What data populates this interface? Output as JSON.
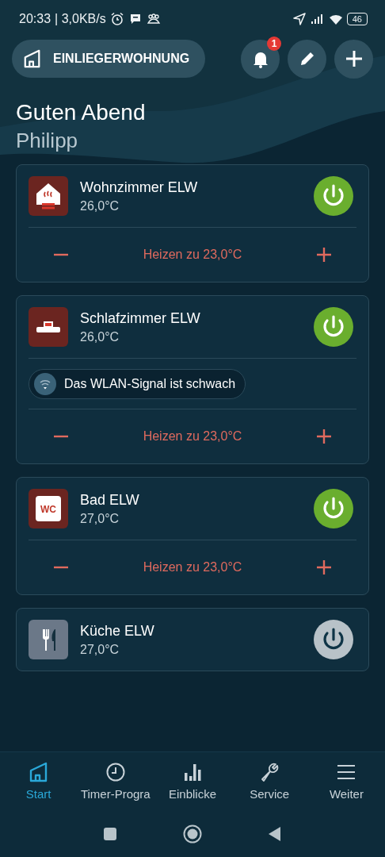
{
  "status_bar": {
    "time": "20:33",
    "speed": "| 3,0KB/s",
    "battery": "46"
  },
  "header": {
    "home_name": "EINLIEGERWOHNUNG",
    "notification_count": "1"
  },
  "greeting": {
    "line1": "Guten Abend",
    "line2": "Philipp"
  },
  "rooms": [
    {
      "kind": "heater",
      "name": "Wohnzimmer ELW",
      "temperature": "26,0°C",
      "on": true,
      "setpoint": "Heizen zu 23,0°C"
    },
    {
      "kind": "bed",
      "name": "Schlafzimmer ELW",
      "temperature": "26,0°C",
      "on": true,
      "warning": "Das WLAN-Signal ist schwach",
      "setpoint": "Heizen zu 23,0°C"
    },
    {
      "kind": "wc",
      "name": "Bad ELW",
      "temperature": "27,0°C",
      "on": true,
      "icon_text": "WC",
      "setpoint": "Heizen zu 23,0°C"
    },
    {
      "kind": "kitchen",
      "name": "Küche ELW",
      "temperature": "27,0°C",
      "on": false
    }
  ],
  "nav": [
    {
      "kind": "home",
      "label": "Start",
      "selected": true
    },
    {
      "kind": "clock",
      "label": "Timer-Progra",
      "selected": false
    },
    {
      "kind": "bars",
      "label": "Einblicke",
      "selected": false
    },
    {
      "kind": "wrench",
      "label": "Service",
      "selected": false
    },
    {
      "kind": "menu",
      "label": "Weiter",
      "selected": false
    }
  ]
}
